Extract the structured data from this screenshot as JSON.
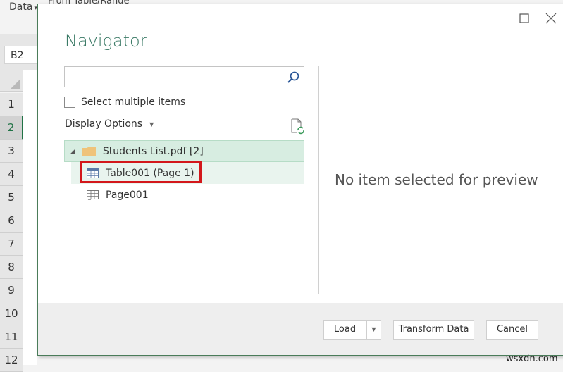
{
  "excel": {
    "ribbon_data_label": "Data",
    "ribbon_from_table_label": "From Table/Range",
    "name_box": "B2",
    "row_headers": [
      "1",
      "2",
      "3",
      "4",
      "5",
      "6",
      "7",
      "8",
      "9",
      "10",
      "11",
      "12"
    ],
    "active_row": "2"
  },
  "dialog": {
    "title": "Navigator",
    "search": {
      "value": "",
      "placeholder": ""
    },
    "select_multiple_label": "Select multiple items",
    "select_multiple_checked": false,
    "display_options_label": "Display Options",
    "tree": {
      "root": {
        "label": "Students List.pdf [2]",
        "icon": "folder-icon",
        "expanded": true
      },
      "items": [
        {
          "label": "Table001 (Page 1)",
          "icon": "table-icon",
          "highlighted": true
        },
        {
          "label": "Page001",
          "icon": "page-icon",
          "highlighted": false
        }
      ]
    },
    "preview_message": "No item selected for preview",
    "buttons": {
      "load": "Load",
      "transform": "Transform Data",
      "cancel": "Cancel"
    },
    "highlight_color": "#d3171b",
    "accent_color": "#3b7a66"
  },
  "watermark": "wsxdn.com"
}
